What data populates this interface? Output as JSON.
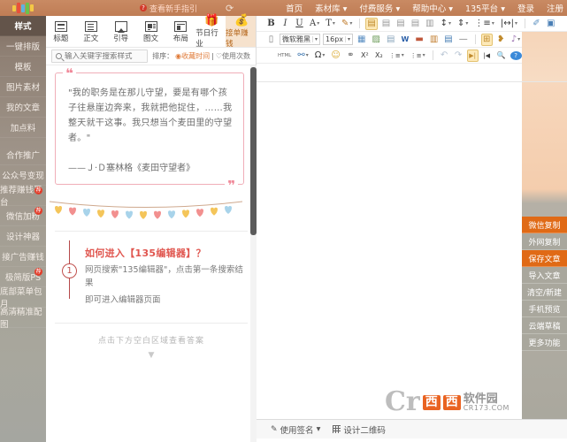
{
  "topbar": {
    "guide_label": "查看新手指引",
    "guide_badge": "?",
    "refresh_icon": "refresh-icon",
    "nav": [
      {
        "label": "首页",
        "caret": false
      },
      {
        "label": "素材库",
        "caret": true
      },
      {
        "label": "付费服务",
        "caret": true
      },
      {
        "label": "帮助中心",
        "caret": true
      },
      {
        "label": "135平台",
        "caret": true
      },
      {
        "label": "登录",
        "caret": false
      },
      {
        "label": "注册",
        "caret": false
      }
    ]
  },
  "sidebar": {
    "items": [
      {
        "label": "样式",
        "active": true,
        "badge": null
      },
      {
        "label": "一键排版",
        "active": false,
        "badge": null
      },
      {
        "label": "模板",
        "active": false,
        "badge": null
      },
      {
        "label": "图片素材",
        "active": false,
        "badge": null
      },
      {
        "label": "我的文章",
        "active": false,
        "badge": null
      },
      {
        "label": "加点料",
        "active": false,
        "badge": null
      },
      {
        "label": "合作推广",
        "active": false,
        "badge": null
      },
      {
        "label": "公众号变现",
        "active": false,
        "badge": null
      },
      {
        "label": "推荐赚钱平台",
        "active": false,
        "badge": "荐"
      },
      {
        "label": "微信加粉",
        "active": false,
        "badge": "荐"
      },
      {
        "label": "设计神器",
        "active": false,
        "badge": null
      },
      {
        "label": "接广告赚钱",
        "active": false,
        "badge": null
      },
      {
        "label": "极简版PS",
        "active": false,
        "badge": "荐"
      },
      {
        "label": "底部菜单包月",
        "active": false,
        "badge": null
      },
      {
        "label": "高清精准配图",
        "active": false,
        "badge": null
      }
    ]
  },
  "categories": [
    {
      "label": "标题",
      "icon": "title-icon",
      "active": false
    },
    {
      "label": "正文",
      "icon": "body-text-icon",
      "active": false
    },
    {
      "label": "引导",
      "icon": "guide-icon",
      "active": false
    },
    {
      "label": "图文",
      "icon": "image-text-icon",
      "active": false
    },
    {
      "label": "布局",
      "icon": "layout-icon",
      "active": false
    },
    {
      "label": "节日行业",
      "icon": "gift-icon",
      "active": false
    },
    {
      "label": "接单赚钱",
      "icon": "money-bag-icon",
      "active": true
    }
  ],
  "search": {
    "placeholder": "输入关键字搜索样式",
    "value": "",
    "icon": "search-icon",
    "sort_label": "排序：",
    "sort_option_1": "收藏时间",
    "sort_divider": "|",
    "sort_option_2": "使用次数"
  },
  "stage": {
    "quote": {
      "open_mark": "❝",
      "close_mark": "❞",
      "text": "\"我的职务是在那儿守望，要是有哪个孩子往悬崖边奔来，我就把他捉住，……我整天就干这事。我只想当个麦田里的守望者。\"",
      "author": "——Ｊ·Ｄ塞林格《麦田守望者》"
    },
    "garland_name": "heart-garland-decoration",
    "step": {
      "number": "1",
      "title": "如何进入【135编辑器】？",
      "desc_line_1": "网页搜索\"135编辑器\"，点击第一条搜索结果",
      "desc_line_2": "即可进入编辑器页面"
    },
    "hint": "点击下方空白区域查看答案",
    "hint_arrow": "▼"
  },
  "toolbar": {
    "row1": [
      {
        "name": "bold-button",
        "glyph": "B",
        "selected": false
      },
      {
        "name": "italic-button",
        "glyph": "I",
        "selected": false
      },
      {
        "name": "underline-button",
        "glyph": "U",
        "selected": false
      },
      {
        "name": "font-color-button",
        "glyph": "A",
        "selected": false,
        "caret": true
      },
      {
        "name": "text-background-color-button",
        "glyph": "T",
        "selected": false,
        "caret": true
      },
      {
        "name": "format-painter-button",
        "glyph": "✎",
        "selected": false,
        "caret": true
      },
      {
        "name": "align-left-button",
        "glyph": "▤",
        "selected": true
      },
      {
        "name": "align-center-button",
        "glyph": "▤",
        "selected": false
      },
      {
        "name": "align-right-button",
        "glyph": "▤",
        "selected": false
      },
      {
        "name": "justify-button",
        "glyph": "▤",
        "selected": false
      },
      {
        "name": "vertical-align-button",
        "glyph": "▥",
        "selected": false
      },
      {
        "name": "line-height-button",
        "glyph": "↕",
        "selected": false,
        "caret": true
      },
      {
        "name": "paragraph-spacing-button",
        "glyph": "⇕",
        "selected": false,
        "caret": true
      },
      {
        "name": "ordered-list-button",
        "glyph": "⋮≡",
        "selected": false,
        "caret": true
      },
      {
        "name": "letter-spacing-button",
        "glyph": "|↔|",
        "selected": false,
        "caret": true
      },
      {
        "name": "clear-format-button",
        "glyph": "✐",
        "selected": false
      },
      {
        "name": "fullscreen-button",
        "glyph": "▣",
        "selected": false
      }
    ],
    "row2": {
      "new-doc-button": "▯",
      "font_family": "微软雅黑",
      "font_size": "16px",
      "items": [
        {
          "name": "insert-table-button",
          "glyph": "▦"
        },
        {
          "name": "insert-image-button",
          "glyph": "▨"
        },
        {
          "name": "remote-image-button",
          "glyph": "▤"
        },
        {
          "name": "import-word-button",
          "glyph": "W"
        },
        {
          "name": "insert-card-button",
          "glyph": "▬"
        },
        {
          "name": "insert-gallery-button",
          "glyph": "▥"
        },
        {
          "name": "insert-page-button",
          "glyph": "▤"
        },
        {
          "name": "horizontal-rule-button",
          "glyph": "—"
        },
        {
          "name": "insert-frame-button",
          "glyph": "⊞"
        },
        {
          "name": "paint-brush-button",
          "glyph": "❥"
        },
        {
          "name": "music-note-button",
          "glyph": "♪"
        }
      ]
    },
    "row3": [
      {
        "name": "source-code-button",
        "glyph": "HTML"
      },
      {
        "name": "link-button",
        "glyph": "⚯",
        "caret": true
      },
      {
        "name": "special-character-button",
        "glyph": "Ω",
        "caret": true
      },
      {
        "name": "emoji-button",
        "glyph": "☺"
      },
      {
        "name": "anchor-button",
        "glyph": "⚭"
      },
      {
        "name": "superscript-button",
        "glyph": "X²"
      },
      {
        "name": "subscript-button",
        "glyph": "X₂"
      },
      {
        "name": "unordered-list-button",
        "glyph": "⋮≡",
        "caret": true
      },
      {
        "name": "ordered-list-button-2",
        "glyph": "⋮≡",
        "caret": true
      },
      {
        "name": "undo-button",
        "glyph": "↶"
      },
      {
        "name": "redo-button",
        "glyph": "↷"
      },
      {
        "name": "rtl-button",
        "glyph": "▶|",
        "selected": true
      },
      {
        "name": "ltr-button",
        "glyph": "|◀"
      },
      {
        "name": "search-replace-button",
        "glyph": "🔍"
      },
      {
        "name": "help-button",
        "glyph": "?"
      }
    ]
  },
  "right_buttons": [
    {
      "label": "微信复制",
      "style": "hot"
    },
    {
      "label": "外网复制",
      "style": "plain"
    },
    {
      "label": "保存文章",
      "style": "hot"
    },
    {
      "label": "导入文章",
      "style": "plain"
    },
    {
      "label": "清空/新建",
      "style": "plain"
    },
    {
      "label": "手机预览",
      "style": "plain"
    },
    {
      "label": "云端草稿",
      "style": "plain"
    },
    {
      "label": "更多功能",
      "style": "plain"
    }
  ],
  "statusbar": {
    "signature_label": "使用签名",
    "signature_icon": "pen-icon",
    "signature_caret": "▾",
    "qrcode_label": "设计二维码",
    "qrcode_icon": "qrcode-icon"
  },
  "watermark": {
    "letter": "Cr",
    "box1": "西",
    "box2": "西",
    "name": "软件园",
    "url": "CR173.COM"
  },
  "colors": {
    "topbar": "#bf7d55",
    "accent_orange": "#e06a16",
    "sidebar": "#a5a095",
    "quote_border": "#f0aeb8",
    "step_red": "#e0564f"
  }
}
